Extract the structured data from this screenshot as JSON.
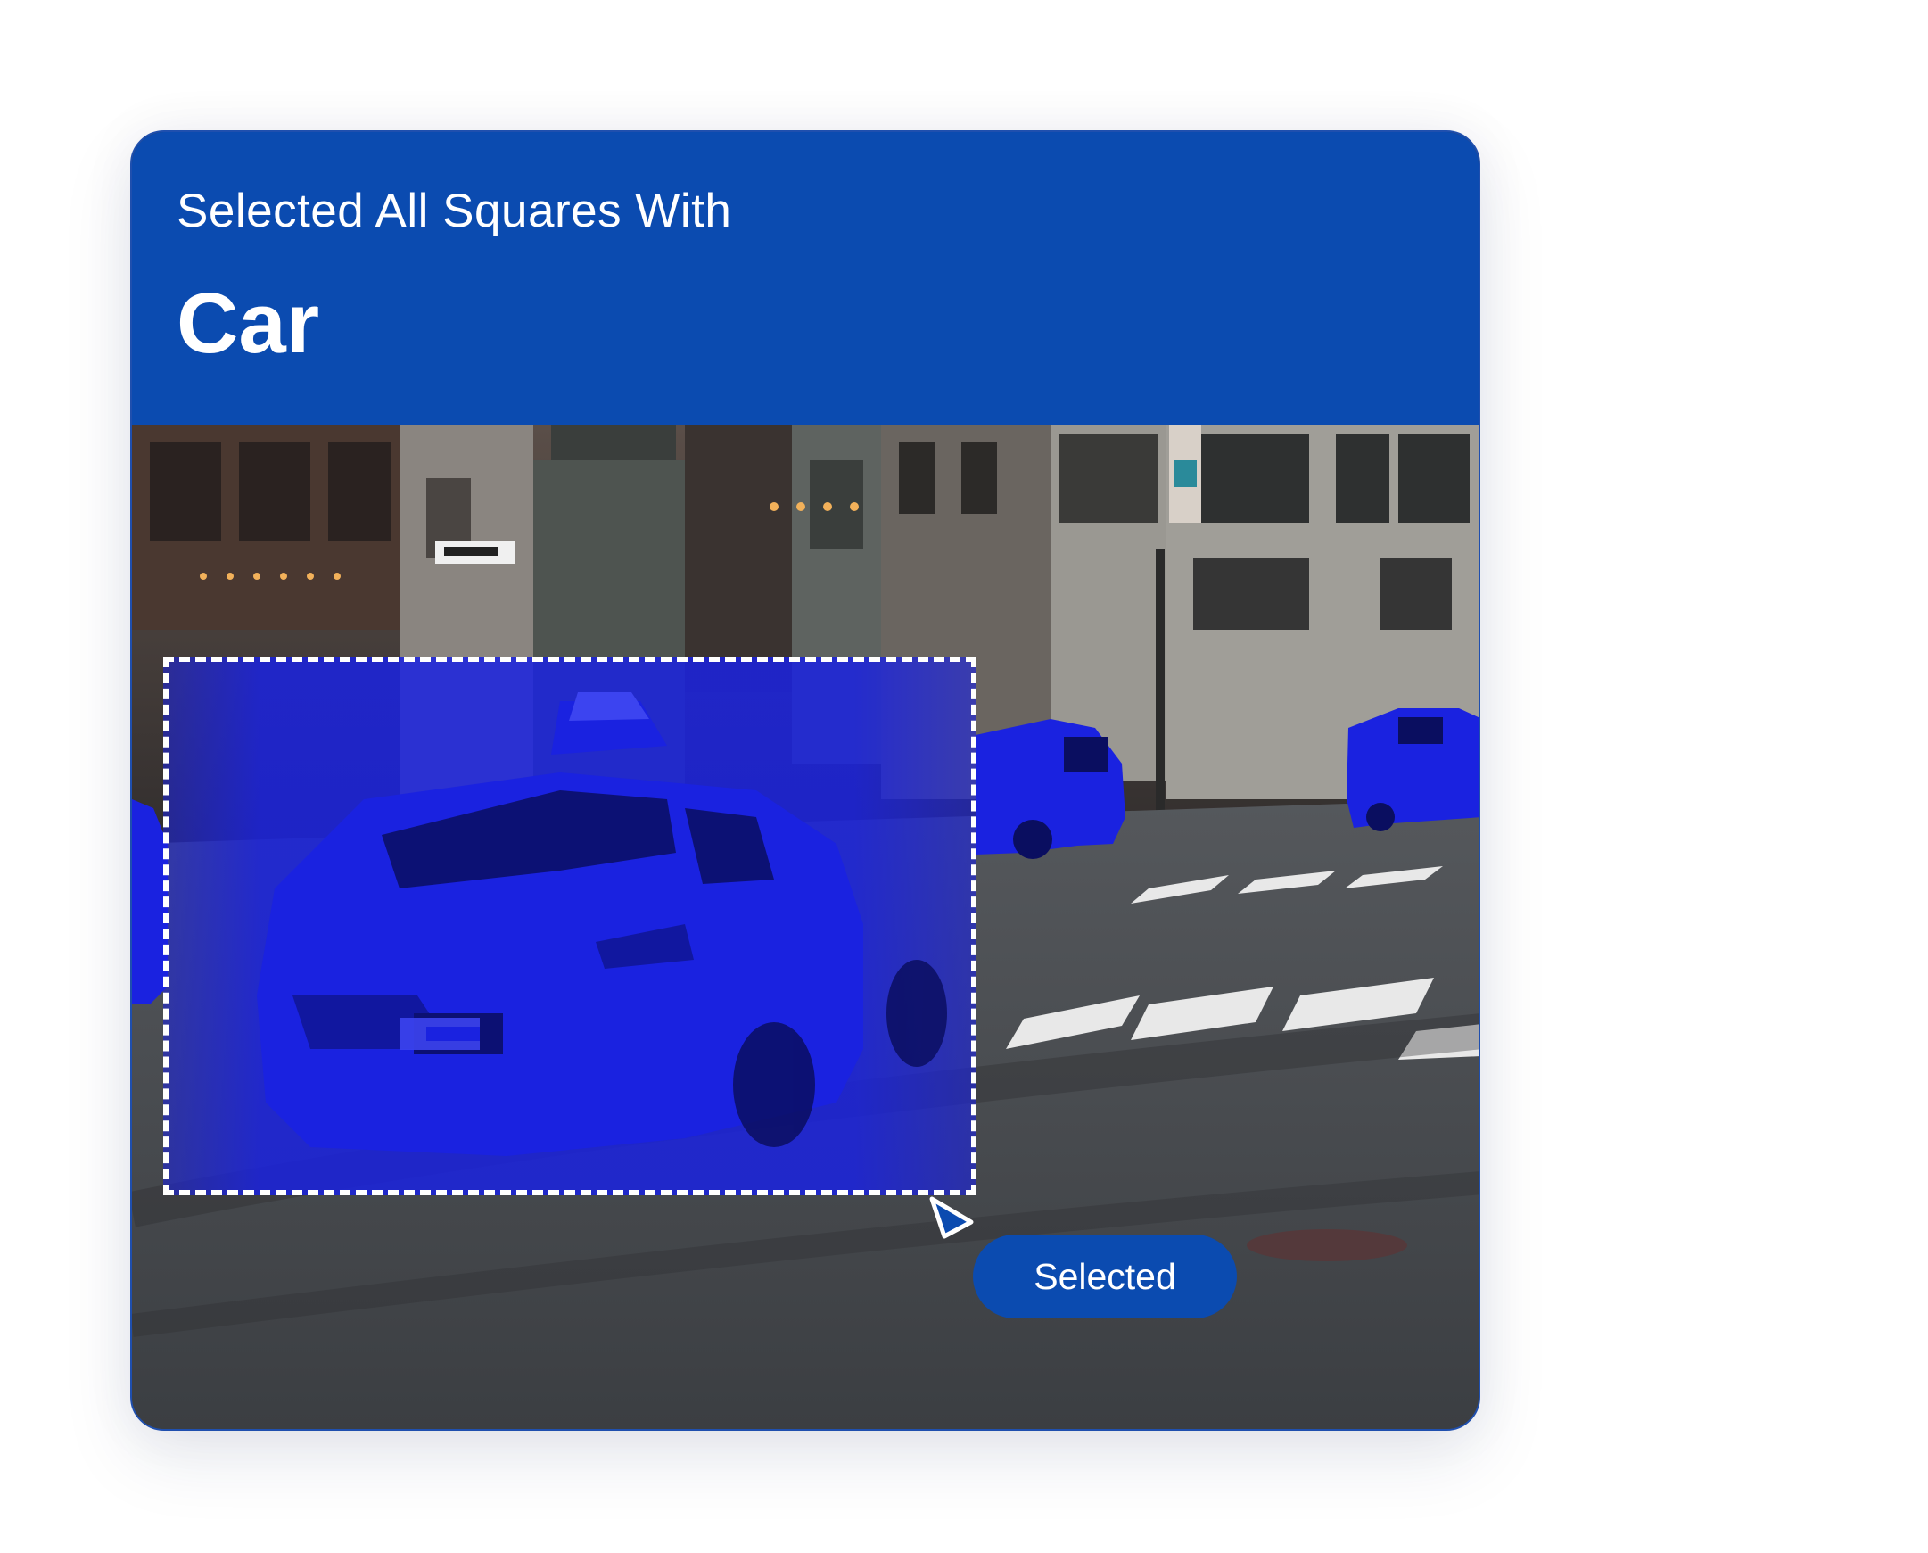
{
  "captcha": {
    "instruction": "Selected All Squares With",
    "target_object": "Car",
    "button_label": "Selected",
    "image_alt": "City street with taxi cars highlighted in blue",
    "highlight_color": "#1a22e0",
    "brand_color": "#0b4bb0"
  }
}
